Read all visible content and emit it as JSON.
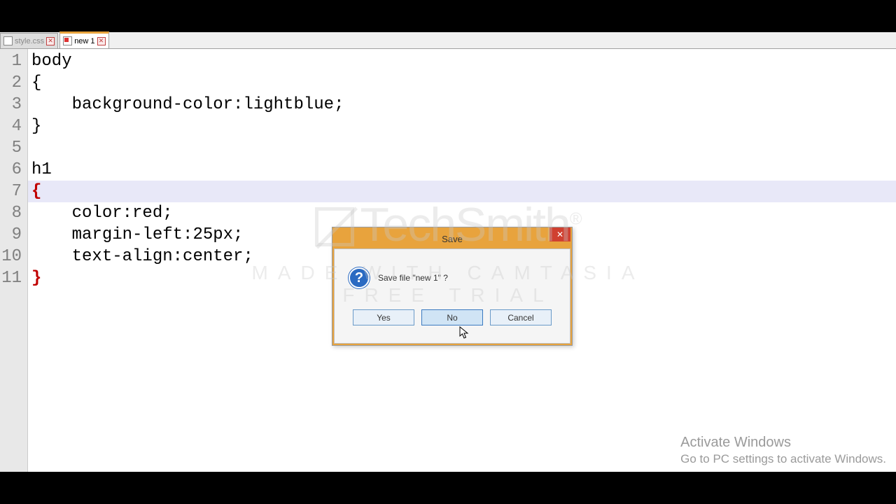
{
  "tabs": [
    {
      "label": "style.css",
      "active": false
    },
    {
      "label": "new 1",
      "active": true
    }
  ],
  "gutter_lines": [
    "1",
    "2",
    "3",
    "4",
    "5",
    "6",
    "7",
    "8",
    "9",
    "10",
    "11"
  ],
  "code_lines": [
    {
      "text": "body",
      "cls": ""
    },
    {
      "text": "{",
      "cls": ""
    },
    {
      "text": "    background-color:lightblue;",
      "cls": ""
    },
    {
      "text": "}",
      "cls": ""
    },
    {
      "text": "",
      "cls": ""
    },
    {
      "text": "h1",
      "cls": ""
    },
    {
      "text": "{",
      "cls": "brace-red"
    },
    {
      "text": "    color:red;",
      "cls": ""
    },
    {
      "text": "    margin-left:25px;",
      "cls": ""
    },
    {
      "text": "    text-align:center;",
      "cls": ""
    },
    {
      "text": "}",
      "cls": "brace-red"
    }
  ],
  "dialog": {
    "title": "Save",
    "message": "Save file \"new 1\" ?",
    "buttons": {
      "yes": "Yes",
      "no": "No",
      "cancel": "Cancel"
    }
  },
  "watermark": {
    "brand": "TechSmith",
    "tagline": "MADE WITH CAMTASIA FREE TRIAL"
  },
  "activate": {
    "heading": "Activate Windows",
    "sub": "Go to PC settings to activate Windows."
  }
}
